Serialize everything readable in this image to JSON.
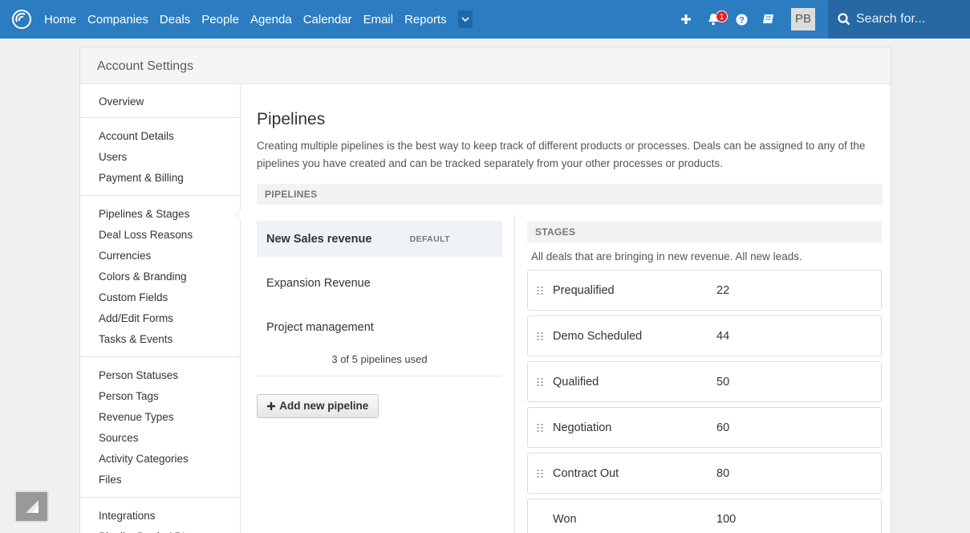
{
  "nav": {
    "items": [
      {
        "label": "Home"
      },
      {
        "label": "Companies"
      },
      {
        "label": "Deals"
      },
      {
        "label": "People"
      },
      {
        "label": "Agenda"
      },
      {
        "label": "Calendar"
      },
      {
        "label": "Email"
      },
      {
        "label": "Reports"
      }
    ],
    "notification_count": "1",
    "avatar_initials": "PB",
    "search_placeholder": "Search for...",
    "accent_color": "#2b7cc0"
  },
  "panel": {
    "header": "Account Settings"
  },
  "sidebar": {
    "groups": [
      {
        "items": [
          {
            "label": "Overview"
          }
        ]
      },
      {
        "items": [
          {
            "label": "Account Details"
          },
          {
            "label": "Users"
          },
          {
            "label": "Payment & Billing"
          }
        ]
      },
      {
        "items": [
          {
            "label": "Pipelines & Stages",
            "active": true
          },
          {
            "label": "Deal Loss Reasons"
          },
          {
            "label": "Currencies"
          },
          {
            "label": "Colors & Branding"
          },
          {
            "label": "Custom Fields"
          },
          {
            "label": "Add/Edit Forms"
          },
          {
            "label": "Tasks & Events"
          }
        ]
      },
      {
        "items": [
          {
            "label": "Person Statuses"
          },
          {
            "label": "Person Tags"
          },
          {
            "label": "Revenue Types"
          },
          {
            "label": "Sources"
          },
          {
            "label": "Activity Categories"
          },
          {
            "label": "Files"
          }
        ]
      },
      {
        "items": [
          {
            "label": "Integrations"
          },
          {
            "label": "PipelineDeals API"
          }
        ]
      }
    ]
  },
  "main": {
    "title": "Pipelines",
    "description": "Creating multiple pipelines is the best way to keep track of different products or processes. Deals can be assigned to any of the pipelines you have created and can be tracked separately from your other processes or products.",
    "pipelines_header": "PIPELINES",
    "pipelines": [
      {
        "name": "New Sales revenue",
        "badge": "DEFAULT",
        "selected": true
      },
      {
        "name": "Expansion Revenue"
      },
      {
        "name": "Project management"
      }
    ],
    "usage": "3 of 5 pipelines used",
    "add_button": "Add new pipeline",
    "stages_header": "STAGES",
    "stages_description": "All deals that are bringing in new revenue. All new leads.",
    "stages": [
      {
        "name": "Prequalified",
        "probability": "22"
      },
      {
        "name": "Demo Scheduled",
        "probability": "44"
      },
      {
        "name": "Qualified",
        "probability": "50"
      },
      {
        "name": "Negotiation",
        "probability": "60"
      },
      {
        "name": "Contract Out",
        "probability": "80"
      },
      {
        "name": "Won",
        "probability": "100"
      }
    ]
  }
}
